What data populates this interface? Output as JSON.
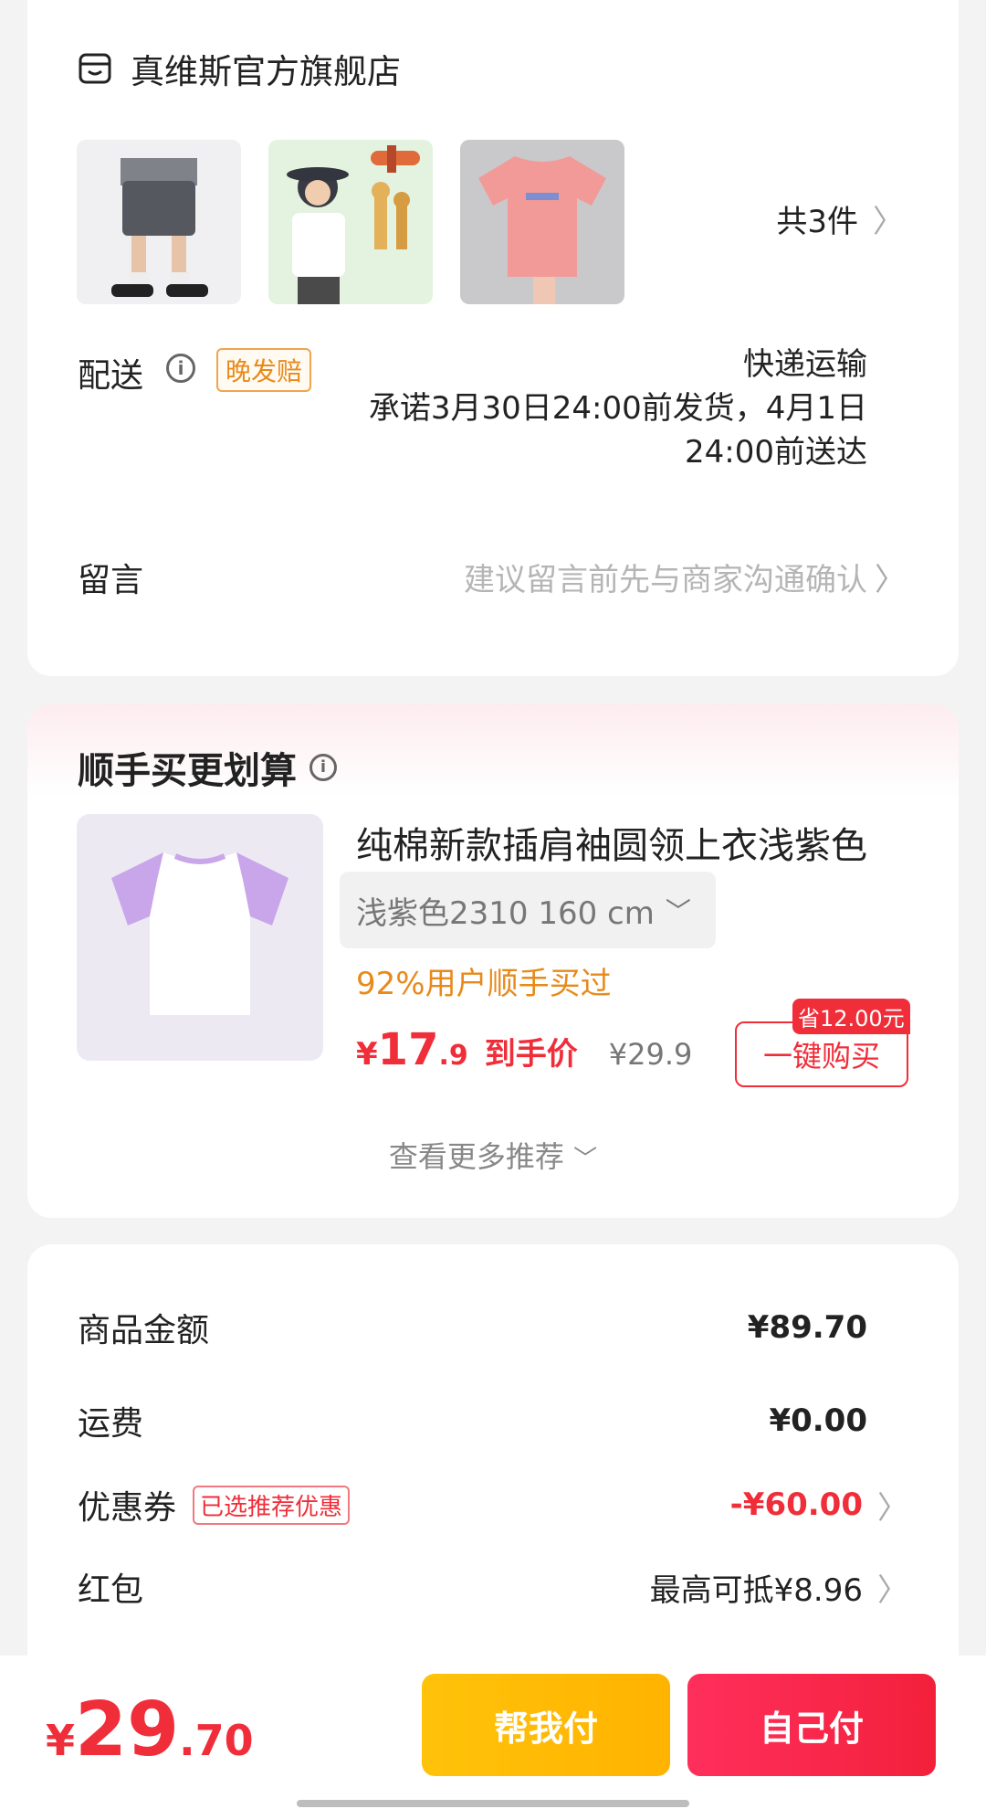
{
  "shop": {
    "name": "真维斯官方旗舰店",
    "item_count_label": "共3件",
    "items": [
      {
        "icon": "shorts-image"
      },
      {
        "icon": "kid-tshirt-image"
      },
      {
        "icon": "pink-tshirt-image"
      }
    ]
  },
  "delivery": {
    "label": "配送",
    "late_tag": "晚发赔",
    "method": "快递运输",
    "promise_line1": "承诺3月30日24:00前发货，4月1日",
    "promise_line2": "24:00前送达"
  },
  "note": {
    "label": "留言",
    "placeholder": "建议留言前先与商家沟通确认"
  },
  "recommend": {
    "title": "顺手买更划算",
    "product_name": "纯棉新款插肩袖圆领上衣浅紫色",
    "variant": "浅紫色2310   160 cm",
    "promo": "92%用户顺手买过",
    "price_currency": "¥",
    "price_int": "17",
    "price_dec": ".9",
    "price_label": "到手价",
    "orig_price": "¥29.9",
    "save_badge": "省12.00元",
    "buy_button": "一键购买",
    "more_label": "查看更多推荐"
  },
  "summary": {
    "goods_label": "商品金额",
    "goods_value": "¥89.70",
    "shipping_label": "运费",
    "shipping_value": "¥0.00",
    "coupon_label": "优惠券",
    "coupon_tag": "已选推荐优惠",
    "coupon_value": "-¥60.00",
    "redpacket_label": "红包",
    "redpacket_value": "最高可抵¥8.96"
  },
  "bottom": {
    "currency": "¥",
    "total_int": "29",
    "total_dec": ".70",
    "help_pay": "帮我付",
    "self_pay": "自己付"
  },
  "colors": {
    "accent_red": "#f02e3a",
    "accent_orange": "#e88a1a",
    "help_button": "#ffb300",
    "self_button": "#f3203b"
  }
}
